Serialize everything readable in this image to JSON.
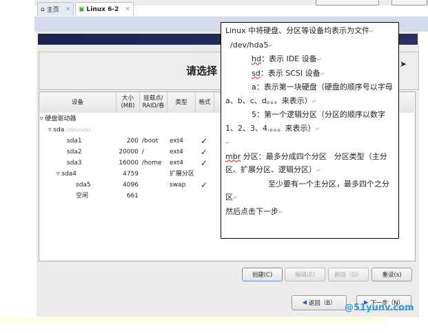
{
  "tabs": [
    {
      "label": "主页",
      "icon": "home-icon"
    },
    {
      "label": "Linux 6-2",
      "icon": "vm-icon"
    }
  ],
  "header": {
    "title": "请选择"
  },
  "table": {
    "columns": [
      "设备",
      "大小\n(MB)",
      "挂载点/\nRAID/卷",
      "类型",
      "格式"
    ],
    "group": "硬盘驱动器",
    "disk": {
      "name": "sda",
      "path": "(/dev/sda)"
    },
    "rows": [
      {
        "device": "sda1",
        "size": "200",
        "mount": "/boot",
        "type": "ext4",
        "format": true,
        "level": 2
      },
      {
        "device": "sda2",
        "size": "20000",
        "mount": "/",
        "type": "ext4",
        "format": true,
        "level": 2
      },
      {
        "device": "sda3",
        "size": "16000",
        "mount": "/home",
        "type": "ext4",
        "format": true,
        "level": 2
      },
      {
        "device": "sda4",
        "size": "4759",
        "mount": "",
        "type": "扩展分区",
        "format": false,
        "level": 2,
        "expanded": true
      },
      {
        "device": "sda5",
        "size": "4096",
        "mount": "",
        "type": "swap",
        "format": true,
        "level": 3
      },
      {
        "device": "空闲",
        "size": "661",
        "mount": "",
        "type": "",
        "format": false,
        "level": 3
      }
    ]
  },
  "actions": {
    "create": "创建(C)",
    "edit": "编辑(E)",
    "delete": "删除（D）",
    "reset": "重设(s)"
  },
  "nav": {
    "back": "返回（B）",
    "next": "下一步（N）"
  },
  "note": {
    "l1": "Linux 中将硬盘、分区等设备均表示为文件",
    "l2": "/dev/hda5",
    "l3a": "hd",
    "l3b": "：表示 IDE 设备",
    "l4a": "sd",
    "l4b": "：表示 SCSI 设备",
    "l5": "a：表示第一块硬盘（硬盘的顺序号以字母 a、b、c、d。。。来表示）",
    "l6": "5：第一个逻辑分区（分区的顺序以数字 1、2、3、4.。。。来表示）",
    "l7a": "mbr",
    "l7b": " 分区：最多分成四个分区　分区类型（主分区、扩展分区、逻辑分区）",
    "l8": "至少要有一个主分区，最多四个之分区",
    "l9": "然后点击下一步"
  },
  "watermark": "@51yunv.com 运维网"
}
